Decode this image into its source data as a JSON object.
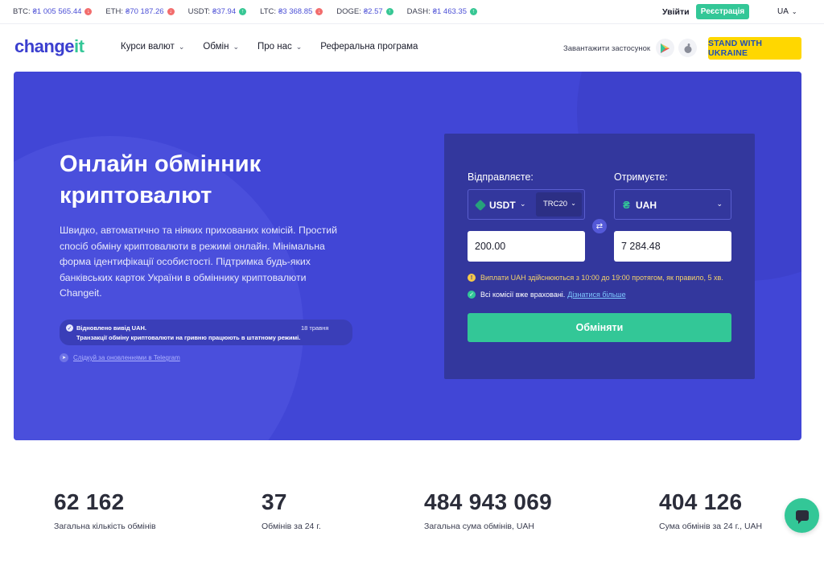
{
  "ticker": [
    {
      "symbol": "BTC:",
      "value": "₴1 005 565.44",
      "trend": "down"
    },
    {
      "symbol": "ETH:",
      "value": "₴70 187.26",
      "trend": "down"
    },
    {
      "symbol": "USDT:",
      "value": "₴37.94",
      "trend": "up"
    },
    {
      "symbol": "LTC:",
      "value": "₴3 368.85",
      "trend": "down"
    },
    {
      "symbol": "DOGE:",
      "value": "₴2.57",
      "trend": "up"
    },
    {
      "symbol": "DASH:",
      "value": "₴1 463.35",
      "trend": "up"
    }
  ],
  "topbar": {
    "login": "Увійти",
    "register": "Реєстрація",
    "lang": "UA"
  },
  "header": {
    "logo_main": "change",
    "logo_accent": "it",
    "nav": [
      "Курси валют",
      "Обмін",
      "Про нас",
      "Реферальна програма"
    ],
    "download_label": "Завантажити застосунок",
    "ukraine_button": "STAND WITH UKRAINE"
  },
  "hero": {
    "title": "Онлайн обмінник криптовалют",
    "description": "Швидко, автоматично та ніяких прихованих комісій. Простий спосіб обміну криптовалюти в режимі онлайн. Мінімальна форма ідентифікації особистості. Підтримка будь-яких банківських карток України в обміннику криптовалюти Changeit.",
    "notice_title": "Відновлено вивід UAH.",
    "notice_text": "Транзакції обміну криптовалюти на гривню працюють в штатному режимі.",
    "notice_date": "18 травня",
    "telegram_link": "Слідкуй за оновленнями в Telegram"
  },
  "exchange": {
    "send_label": "Відправляєте:",
    "receive_label": "Отримуєте:",
    "send_currency": "USDT",
    "send_network": "TRC20",
    "receive_currency": "UAH",
    "send_amount": "200.00",
    "receive_amount": "7 284.48",
    "payout_note": "Виплати UAH здійснюються з 10:00 до 19:00 протягом, як правило, 5 хв.",
    "fees_note": "Всі комісії вже враховані.",
    "fees_link": "Дізнатися більше",
    "submit": "Обміняти"
  },
  "stats": [
    {
      "value": "62 162",
      "caption": "Загальна кількість обмінів"
    },
    {
      "value": "37",
      "caption": "Обмінів за 24 г."
    },
    {
      "value": "484 943 069",
      "caption": "Загальна сума обмінів, UAH"
    },
    {
      "value": "404 126",
      "caption": "Сума обмінів за 24 г., UAH"
    }
  ],
  "colors": {
    "primary": "#4146d6",
    "accent": "#33c797",
    "card": "#33379d",
    "ukraine": "#ffd700"
  },
  "icons": {
    "chat": "chat-icon",
    "google_play": "google-play-icon",
    "apple": "apple-icon"
  }
}
